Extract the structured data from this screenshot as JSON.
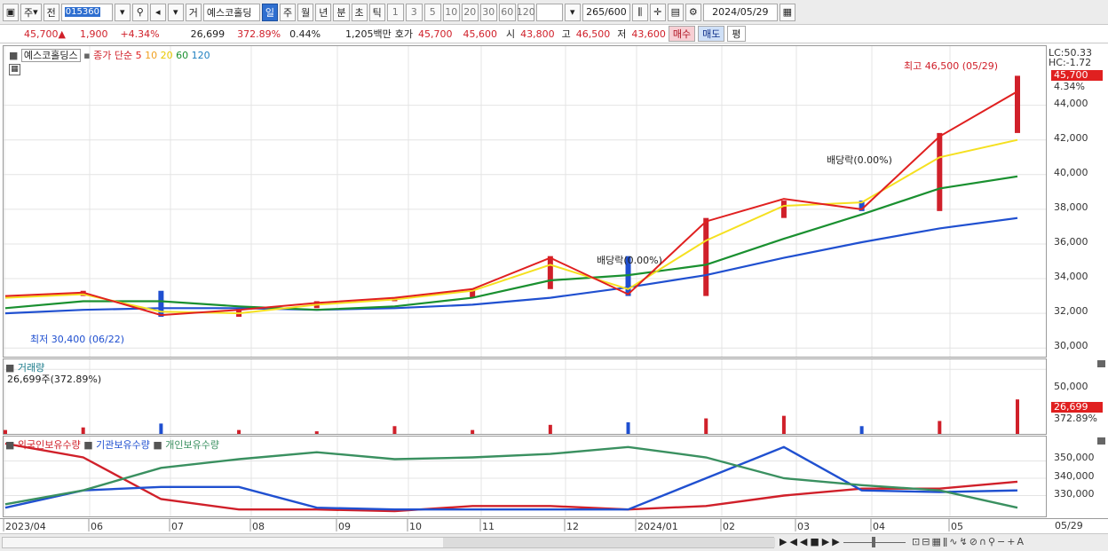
{
  "toolbar": {
    "period_label": "주",
    "prev_label": "전",
    "stock_code": "015360",
    "market_label": "거",
    "stock_name": "예스코홀딩",
    "tabs": [
      "일",
      "주",
      "월",
      "년",
      "분",
      "초",
      "틱"
    ],
    "active_tab": "일",
    "minute_options": [
      "1",
      "3",
      "5",
      "10",
      "20",
      "30",
      "60",
      "120"
    ],
    "data_count": "265",
    "data_max": "/600",
    "date": "2024/05/29"
  },
  "quote": {
    "price": "45,700",
    "change": "1,900",
    "change_pct": "+4.34%",
    "volume": "26,699",
    "volume_ratio": "372.89%",
    "turnover_pct": "0.44%",
    "amount": "1,205백만",
    "bid_label": "호가",
    "ask": "45,700",
    "bid": "45,600",
    "open_label": "시",
    "open": "43,800",
    "high_label": "고",
    "high": "46,500",
    "low_label": "저",
    "low": "43,600",
    "buy_label": "매수",
    "sell_label": "매도",
    "flat_label": "평"
  },
  "colors": {
    "up": "#d0202a",
    "down": "#1f4fd0",
    "ma5": "#e02020",
    "ma10": "#f0a020",
    "ma20": "#f5e020",
    "ma60": "#1a9030",
    "ma120": "#2050d0",
    "foreign": "#d0202a",
    "institution": "#2050d0",
    "individual": "#3a9060"
  },
  "price_panel": {
    "stock_name": "예스코홀딩스",
    "ma_label": "종가 단순",
    "ma_periods": [
      "5",
      "10",
      "20",
      "60",
      "120"
    ],
    "lc": "LC:50.33",
    "hc": "HC:-1.72",
    "last_price": "45,700",
    "last_pct": "4.34%",
    "high_annotation": "최고 46,500 (05/29)",
    "low_annotation": "최저 30,400 (06/22)",
    "dividend_1": "배당락(0.00%)",
    "dividend_2": "배당락(0.00%)",
    "y_ticks": [
      "44,000",
      "42,000",
      "40,000",
      "38,000",
      "36,000",
      "34,000",
      "32,000",
      "30,000"
    ]
  },
  "volume_panel": {
    "title": "거래량",
    "value": "26,699주(372.89%)",
    "y_tick": "50,000",
    "last_value": "26,699",
    "last_pct": "372.89%"
  },
  "holdings_panel": {
    "legend": [
      "외국인보유수량",
      "기관보유수량",
      "개인보유수량"
    ],
    "y_ticks": [
      "350,000",
      "340,000",
      "330,000"
    ]
  },
  "x_axis": {
    "labels": [
      "2023/04",
      "06",
      "07",
      "08",
      "09",
      "10",
      "11",
      "12",
      "2024/01",
      "02",
      "03",
      "04",
      "05"
    ],
    "last_date": "05/29"
  },
  "chart_data": [
    {
      "type": "line",
      "title": "",
      "x": [
        "2023/04",
        "06",
        "07",
        "08",
        "09",
        "10",
        "11",
        "12",
        "2024/01",
        "02",
        "03",
        "04",
        "05",
        "05/29"
      ],
      "series": [
        {
          "name": "종가",
          "values": [
            33000,
            33300,
            31800,
            32300,
            32700,
            32900,
            33400,
            35300,
            33000,
            37500,
            38500,
            37900,
            42400,
            45700
          ]
        },
        {
          "name": "5",
          "values": [
            33000,
            33200,
            31900,
            32200,
            32600,
            32900,
            33400,
            35200,
            33100,
            37300,
            38600,
            38000,
            42200,
            44800
          ]
        },
        {
          "name": "20",
          "values": [
            32900,
            33100,
            32100,
            32000,
            32500,
            32800,
            33300,
            34800,
            33400,
            36200,
            38200,
            38400,
            41000,
            42000
          ]
        },
        {
          "name": "60",
          "values": [
            32300,
            32700,
            32700,
            32400,
            32200,
            32400,
            32900,
            33900,
            34200,
            34800,
            36300,
            37700,
            39200,
            39900
          ]
        },
        {
          "name": "120",
          "values": [
            32000,
            32200,
            32300,
            32300,
            32200,
            32300,
            32500,
            32900,
            33500,
            34200,
            35200,
            36100,
            36900,
            37500
          ]
        }
      ],
      "ylim": [
        29500,
        47000
      ]
    },
    {
      "type": "bar",
      "title": "",
      "x": [
        "2023/04",
        "06",
        "07",
        "08",
        "09",
        "10",
        "11",
        "12",
        "2024/01",
        "02",
        "03",
        "04",
        "05",
        "05/29"
      ],
      "series": [
        {
          "name": "거래량",
          "values": [
            3000,
            5000,
            8000,
            3000,
            2000,
            6000,
            3000,
            7000,
            9000,
            12000,
            14000,
            6000,
            10000,
            26699
          ]
        }
      ],
      "ylim": [
        0,
        55000
      ]
    },
    {
      "type": "line",
      "title": "",
      "x": [
        "2023/04",
        "06",
        "07",
        "08",
        "09",
        "10",
        "11",
        "12",
        "2024/01",
        "02",
        "03",
        "04",
        "05",
        "05/29"
      ],
      "series": [
        {
          "name": "외국인보유수량",
          "values": [
            360000,
            352000,
            328000,
            322000,
            322000,
            321000,
            324000,
            324000,
            322000,
            324000,
            330000,
            334000,
            334000,
            338000
          ]
        },
        {
          "name": "기관보유수량",
          "values": [
            323000,
            333000,
            335000,
            335000,
            323000,
            322000,
            322000,
            322000,
            322000,
            340000,
            358000,
            333000,
            332000,
            333000
          ]
        },
        {
          "name": "개인보유수량",
          "values": [
            325000,
            333000,
            346000,
            351000,
            355000,
            351000,
            352000,
            354000,
            358000,
            352000,
            340000,
            336000,
            333000,
            323000
          ]
        }
      ],
      "ylim": [
        318000,
        362000
      ]
    }
  ]
}
